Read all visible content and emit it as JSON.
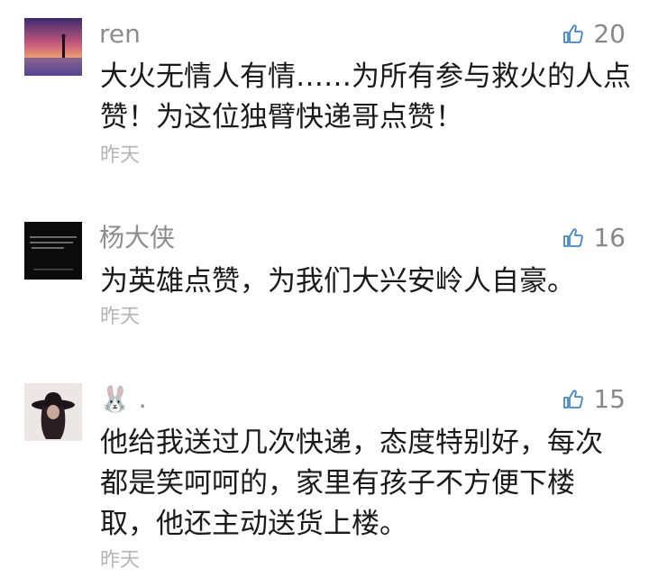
{
  "comments": [
    {
      "user": "ren",
      "likes": "20",
      "lines": [
        "大火无情人有情……为所有参与救火的人点",
        "赞！为这位独臂快递哥点赞！"
      ],
      "time": "昨天",
      "avatar_icon": "sunset-silhouette-avatar"
    },
    {
      "user": "杨大侠",
      "likes": "16",
      "lines": [
        "为英雄点赞，为我们大兴安岭人自豪。"
      ],
      "time": "昨天",
      "avatar_icon": "dark-text-avatar"
    },
    {
      "user": "🐰 .",
      "likes": "15",
      "lines": [
        "他给我送过几次快递，态度特别好，每次",
        "都是笑呵呵的，家里有孩子不方便下楼",
        "取，他还主动送货上楼。"
      ],
      "time": "昨天",
      "avatar_icon": "woman-with-hat-avatar"
    }
  ],
  "icons": {
    "like": "thumbs-up-icon"
  },
  "colors": {
    "like_icon": "#3f86c9",
    "username": "#8d8d8d",
    "body_text": "#1a1a1a",
    "timestamp": "#b5b5b5"
  }
}
